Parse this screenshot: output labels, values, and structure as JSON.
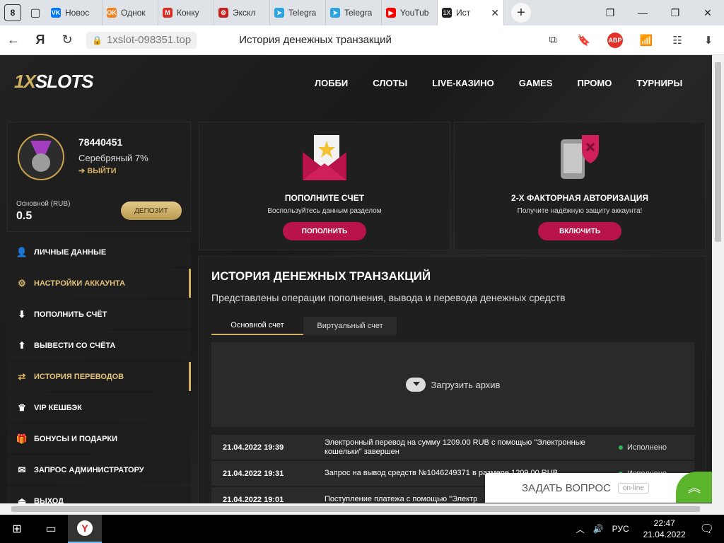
{
  "browser": {
    "tab_count": "8",
    "tabs": [
      {
        "label": "Новос",
        "icon": "vk-icon",
        "color": "#0077ff",
        "glyph": "VK"
      },
      {
        "label": "Однок",
        "icon": "ok-icon",
        "color": "#f58220",
        "glyph": "OK"
      },
      {
        "label": "Конку",
        "icon": "gmail-icon",
        "color": "#d93025",
        "glyph": "M"
      },
      {
        "label": "Экскл",
        "icon": "chrome-icon",
        "color": "#c5221f",
        "glyph": "⚙"
      },
      {
        "label": "Telegra",
        "icon": "telegram-icon",
        "color": "#2aa3e0",
        "glyph": "➤"
      },
      {
        "label": "Telegra",
        "icon": "telegram-icon",
        "color": "#2aa3e0",
        "glyph": "➤"
      },
      {
        "label": "YouTub",
        "icon": "youtube-icon",
        "color": "#ff0000",
        "glyph": "▶"
      }
    ],
    "active_tab": {
      "label": "Ист",
      "glyph": "1X"
    },
    "url": "1xslot-098351.top",
    "page_title": "История денежных транзакций",
    "abp": "ABP"
  },
  "site": {
    "logo_a": "1X",
    "logo_b": "SLOTS",
    "nav": [
      "ЛОББИ",
      "СЛОТЫ",
      "LIVE-КАЗИНО",
      "GAMES",
      "ПРОМО",
      "ТУРНИРЫ"
    ],
    "user": {
      "id": "78440451",
      "rank": "Серебряный 7%",
      "logout": "ВЫЙТИ",
      "balance_label": "Основной (RUB)",
      "balance": "0.5",
      "deposit": "ДЕПОЗИТ"
    },
    "menu": [
      {
        "label": "ЛИЧНЫЕ ДАННЫЕ",
        "icon": "user-add-icon",
        "glyph": "👤",
        "active": false
      },
      {
        "label": "НАСТРОЙКИ АККАУНТА",
        "icon": "settings-icon",
        "glyph": "⚙",
        "active": true
      },
      {
        "label": "ПОПОЛНИТЬ СЧЁТ",
        "icon": "download-icon",
        "glyph": "⬇",
        "active": false
      },
      {
        "label": "ВЫВЕСТИ СО СЧЁТА",
        "icon": "upload-icon",
        "glyph": "⬆",
        "active": false
      },
      {
        "label": "ИСТОРИЯ ПЕРЕВОДОВ",
        "icon": "transfer-icon",
        "glyph": "⇄",
        "active": true
      },
      {
        "label": "VIP КЕШБЭК",
        "icon": "crown-icon",
        "glyph": "♛",
        "active": false
      },
      {
        "label": "БОНУСЫ И ПОДАРКИ",
        "icon": "gift-icon",
        "glyph": "🎁",
        "active": false
      },
      {
        "label": "ЗАПРОС АДМИНИСТРАТОРУ",
        "icon": "mail-icon",
        "glyph": "✉",
        "active": false
      },
      {
        "label": "ВЫХОД",
        "icon": "logout-icon",
        "glyph": "⏏",
        "active": false
      }
    ],
    "cards": [
      {
        "title": "ПОПОЛНИТЕ СЧЕТ",
        "subtitle": "Воспользуйтесь данным разделом",
        "button": "ПОПОЛНИТЬ"
      },
      {
        "title": "2-Х ФАКТОРНАЯ АВТОРИЗАЦИЯ",
        "subtitle": "Получите надёжную защиту аккаунта!",
        "button": "ВКЛЮЧИТЬ"
      }
    ],
    "history": {
      "title": "ИСТОРИЯ ДЕНЕЖНЫХ ТРАНЗАКЦИЙ",
      "subtitle": "Представлены операции пополнения, вывода и перевода денежных средств",
      "tabs": [
        "Основной счет",
        "Виртуальный счет"
      ],
      "upload": "Загрузить архив",
      "rows": [
        {
          "date": "21.04.2022 19:39",
          "text": "Электронный перевод на сумму 1209.00 RUB с помощью \"Электронные кошельки\" завершен",
          "status": "Исполнено"
        },
        {
          "date": "21.04.2022 19:31",
          "text": "Запрос на вывод средств №1046249371 в размере 1209.00 RUB",
          "status": "Исполнено"
        },
        {
          "date": "21.04.2022 19:01",
          "text": "Поступление платежа с помощью \"Электр",
          "status": ""
        }
      ]
    },
    "ask": {
      "label": "ЗАДАТЬ ВОПРОС",
      "online": "on-line"
    }
  },
  "taskbar": {
    "lang": "РУС",
    "time": "22:47",
    "date": "21.04.2022"
  }
}
